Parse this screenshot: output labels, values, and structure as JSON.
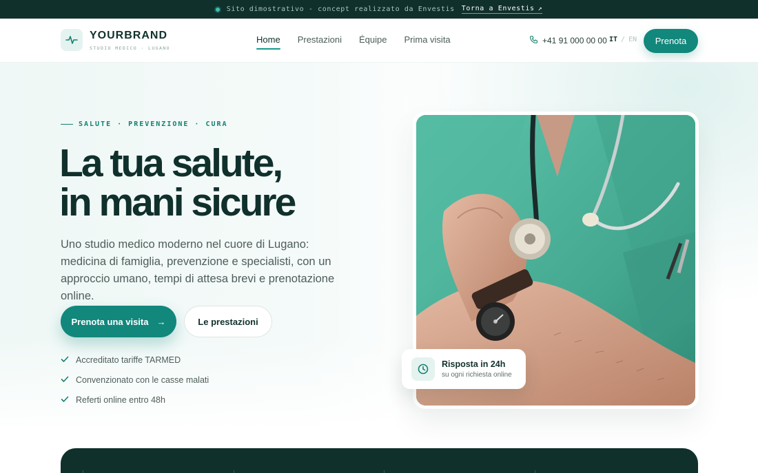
{
  "topbar": {
    "note": "Sito dimostrativo - concept realizzato da Envestis",
    "back_link": "Torna a Envestis",
    "back_arrow": "↗"
  },
  "brand": {
    "name": "YOURBRAND",
    "tagline": "STUDIO MEDICO · LUGANO",
    "icon": "pulse-icon"
  },
  "nav": {
    "items": [
      {
        "label": "Home",
        "active": true
      },
      {
        "label": "Prestazioni",
        "active": false
      },
      {
        "label": "Équipe",
        "active": false
      },
      {
        "label": "Prima visita",
        "active": false
      }
    ]
  },
  "header": {
    "phone": "+41 91 000 00 00",
    "lang_active": "IT",
    "lang_separator": "/",
    "lang_other": "EN",
    "cta": "Prenota"
  },
  "hero": {
    "eyebrow": "SALUTE · PREVENZIONE · CURA",
    "title_line1": "La tua salute,",
    "title_line2": "in mani sicure",
    "lead": "Uno studio medico moderno nel cuore di Lugano: medicina di famiglia, prevenzione e specialisti, con un approccio umano, tempi di attesa brevi e prenotazione online.",
    "primary_cta": "Prenota una visita",
    "primary_arrow": "→",
    "secondary_cta": "Le prestazioni",
    "checks": [
      "Accreditato tariffe TARMED",
      "Convenzionato con le casse malati",
      "Referti online entro 48h"
    ]
  },
  "badge": {
    "title": "Risposta in 24h",
    "subtitle": "su ogni richiesta online",
    "icon": "clock-icon"
  },
  "colors": {
    "accent": "#12877c",
    "dark": "#10302c",
    "mint_bg": "#eff8f6"
  }
}
